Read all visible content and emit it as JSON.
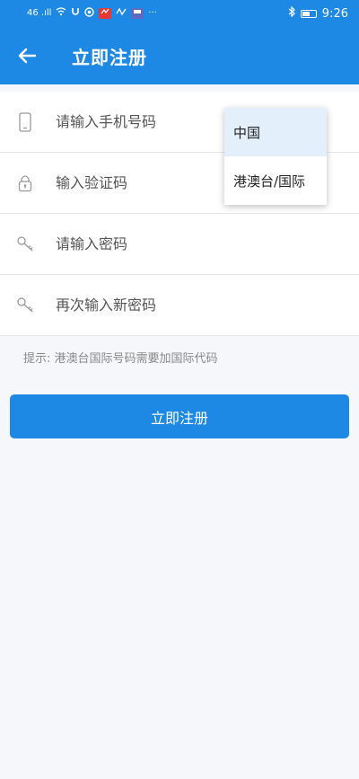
{
  "status_bar": {
    "signal": "46 .ıll",
    "badge1_color": "#e53935",
    "badge2_color": "#5c6bc0",
    "more": "···",
    "time": "9:26"
  },
  "header": {
    "title": "立即注册"
  },
  "form": {
    "phone_placeholder": "请输入手机号码",
    "code_placeholder": "输入验证码",
    "password_placeholder": "请输入密码",
    "confirm_placeholder": "再次输入新密码"
  },
  "hint": "提示: 港澳台国际号码需要加国际代码",
  "submit_label": "立即注册",
  "region_dropdown": {
    "options": [
      "中国",
      "港澳台/国际"
    ],
    "selected": "中国"
  },
  "colors": {
    "primary": "#1e88e5",
    "selected_option": "#e3effb"
  }
}
